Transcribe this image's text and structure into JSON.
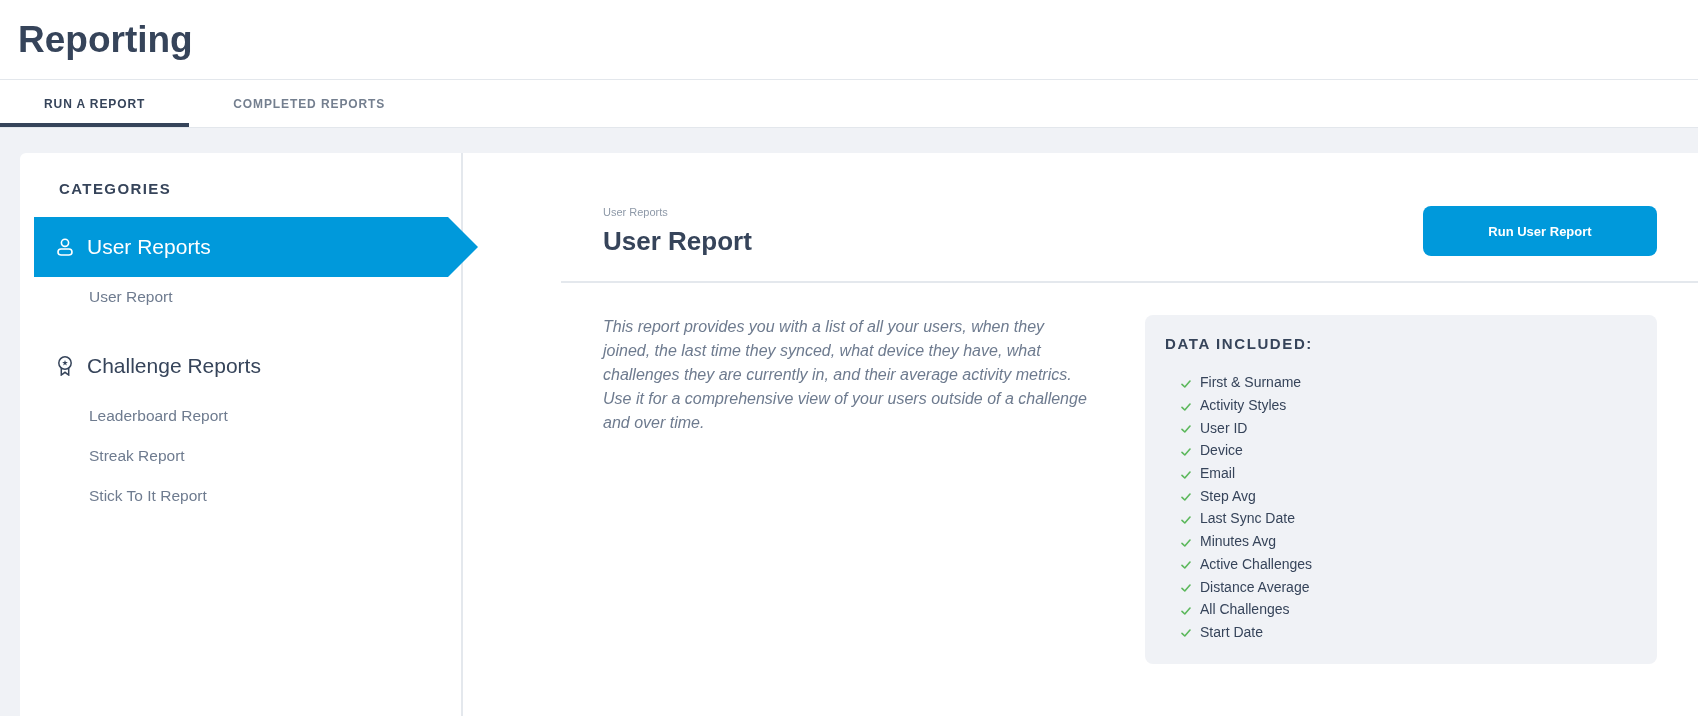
{
  "page": {
    "title": "Reporting"
  },
  "tabs": [
    {
      "label": "RUN A REPORT",
      "selected": true
    },
    {
      "label": "COMPLETED REPORTS",
      "selected": false
    }
  ],
  "sidebar": {
    "heading": "CATEGORIES",
    "groups": [
      {
        "kind": "user",
        "label": "User Reports",
        "selected": true,
        "items": [
          "User Report"
        ]
      },
      {
        "kind": "challenge",
        "label": "Challenge Reports",
        "selected": false,
        "items": [
          "Leaderboard Report",
          "Streak Report",
          "Stick To It Report"
        ]
      }
    ]
  },
  "report": {
    "breadcrumb": "User Reports",
    "title": "User Report",
    "run_button": "Run User Report",
    "description": "This report provides you with a list of all your users, when they joined, the last time they synced, what device they have, what challenges they are currently in, and their average activity metrics. Use it for a comprehensive view of your users outside of a challenge and over time.",
    "data_included": {
      "heading": "DATA INCLUDED:",
      "fields": [
        "First & Surname",
        "Activity Styles",
        "User ID",
        "Device",
        "Email",
        "Step Avg",
        "Last Sync Date",
        "Minutes Avg",
        "Active Challenges",
        "Distance Average",
        "All Challenges",
        "Start Date"
      ]
    }
  }
}
